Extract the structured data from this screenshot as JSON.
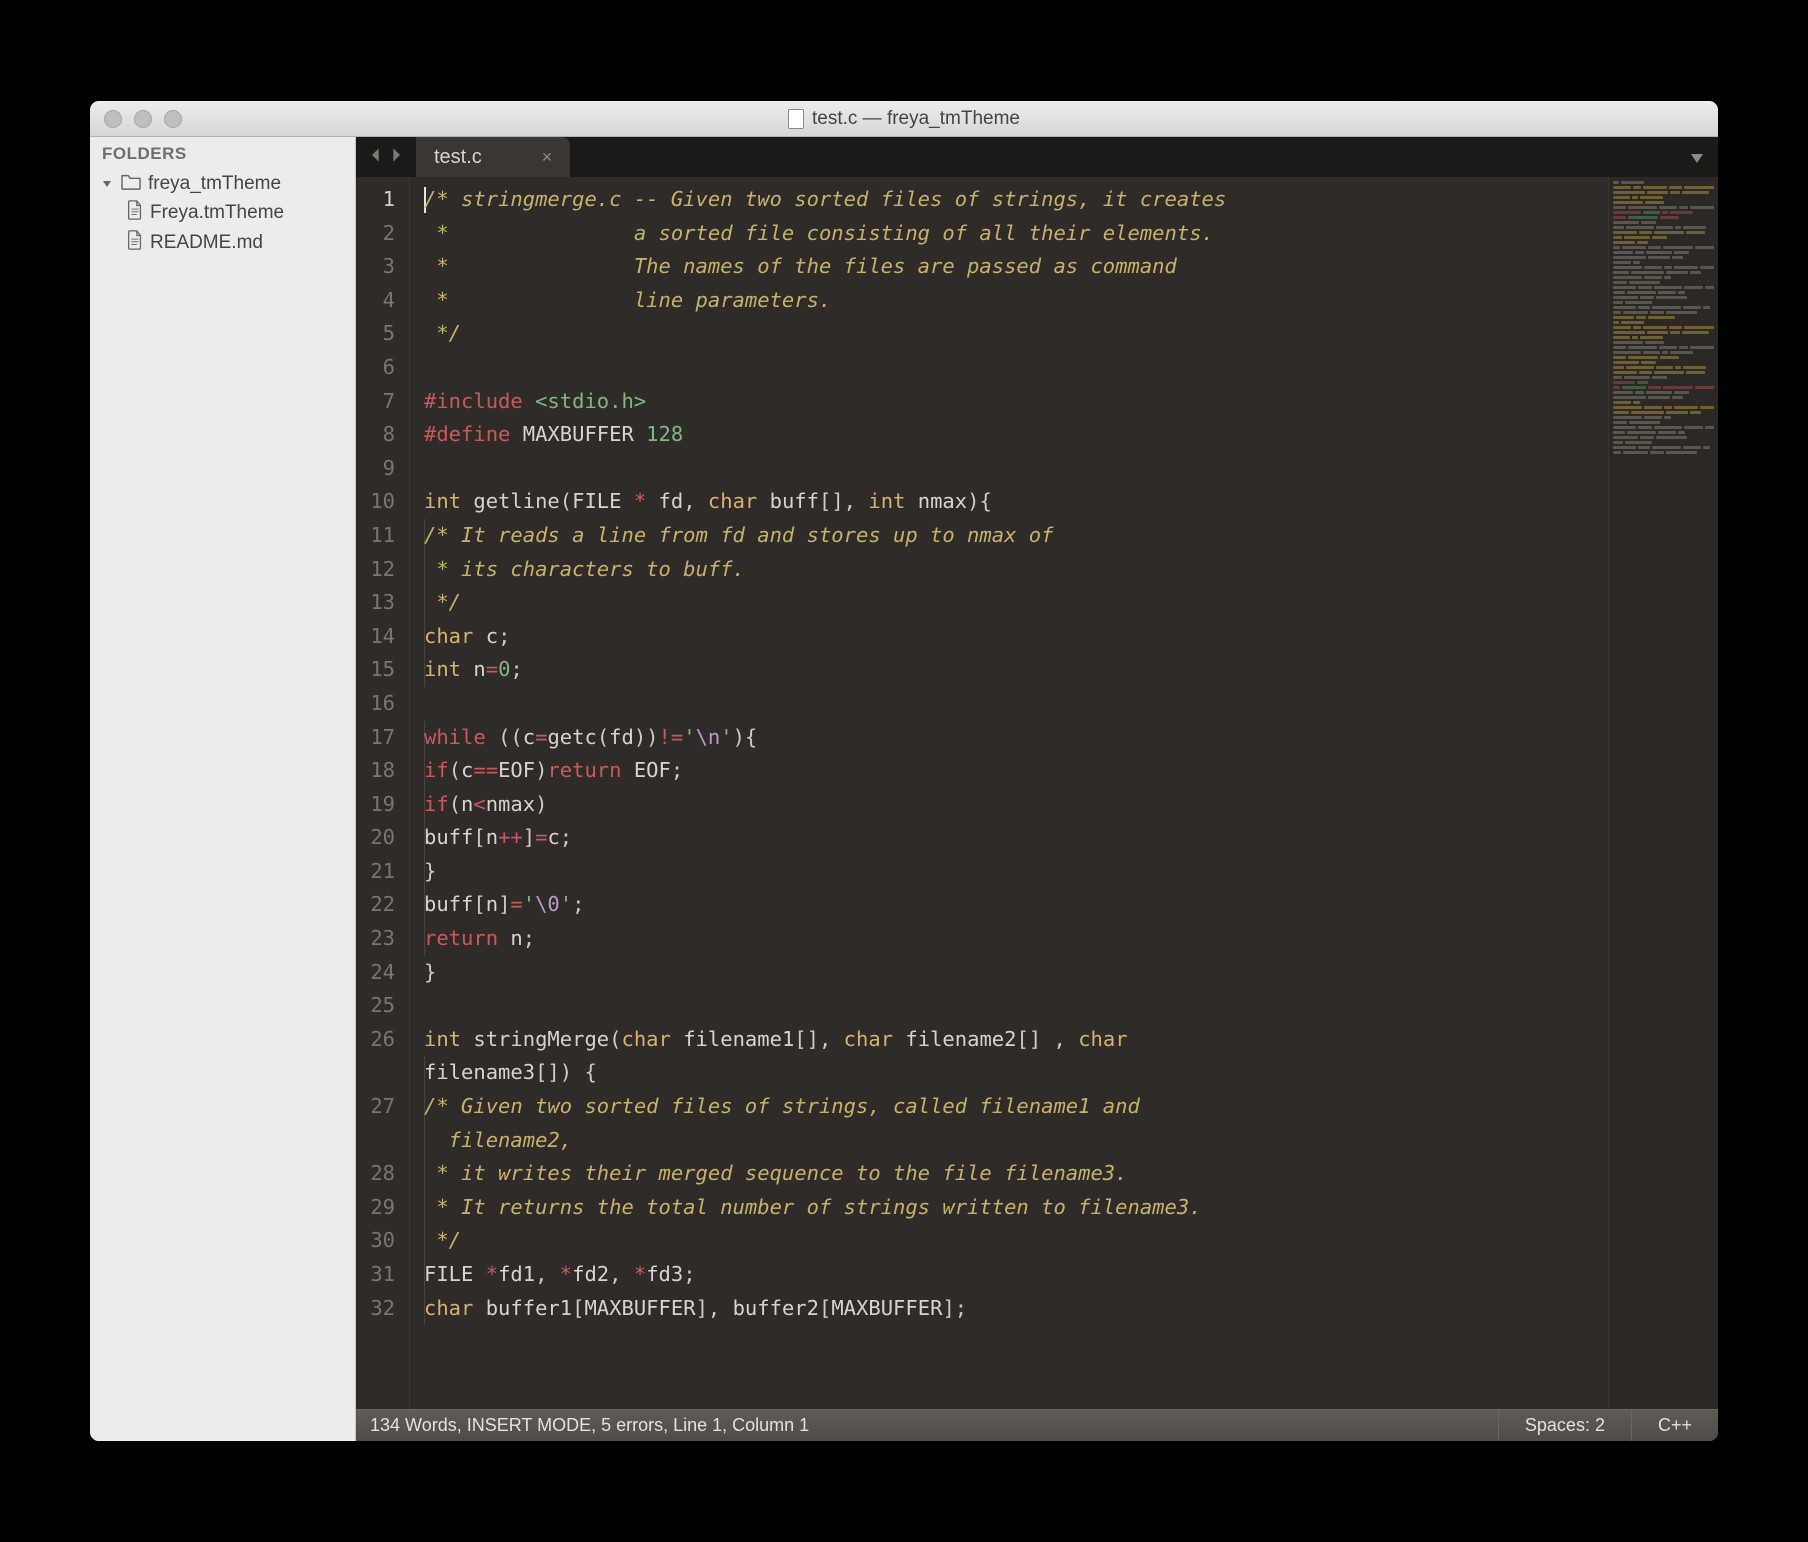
{
  "window": {
    "title": "test.c — freya_tmTheme"
  },
  "sidebar": {
    "header": "FOLDERS",
    "folder": "freya_tmTheme",
    "files": [
      "Freya.tmTheme",
      "README.md"
    ]
  },
  "tabs": {
    "active": "test.c"
  },
  "code": {
    "lines": [
      {
        "n": 1,
        "indent": 0,
        "segs": [
          [
            "cursor",
            ""
          ],
          [
            "c-comment",
            "/* stringmerge.c -- Given two sorted files of strings, it creates"
          ]
        ]
      },
      {
        "n": 2,
        "indent": 0,
        "segs": [
          [
            "c-comment",
            " *               a sorted file consisting of all their elements."
          ]
        ]
      },
      {
        "n": 3,
        "indent": 0,
        "segs": [
          [
            "c-comment",
            " *               The names of the files are passed as command"
          ]
        ]
      },
      {
        "n": 4,
        "indent": 0,
        "segs": [
          [
            "c-comment",
            " *               line parameters."
          ]
        ]
      },
      {
        "n": 5,
        "indent": 0,
        "segs": [
          [
            "c-comment",
            " */"
          ]
        ]
      },
      {
        "n": 6,
        "indent": 0,
        "segs": []
      },
      {
        "n": 7,
        "indent": 0,
        "segs": [
          [
            "c-preproc",
            "#include "
          ],
          [
            "c-string",
            "<stdio.h>"
          ]
        ]
      },
      {
        "n": 8,
        "indent": 0,
        "segs": [
          [
            "c-preproc",
            "#define "
          ],
          [
            "c-ident",
            "MAXBUFFER "
          ],
          [
            "c-number",
            "128"
          ]
        ]
      },
      {
        "n": 9,
        "indent": 0,
        "segs": []
      },
      {
        "n": 10,
        "indent": 0,
        "segs": [
          [
            "c-type",
            "int "
          ],
          [
            "c-func",
            "getline"
          ],
          [
            "c-punct",
            "("
          ],
          [
            "c-ident",
            "FILE "
          ],
          [
            "c-keyword",
            "* "
          ],
          [
            "c-ident",
            "fd"
          ],
          [
            "c-punct",
            ", "
          ],
          [
            "c-type",
            "char "
          ],
          [
            "c-ident",
            "buff"
          ],
          [
            "c-punct",
            "[], "
          ],
          [
            "c-type",
            "int "
          ],
          [
            "c-ident",
            "nmax"
          ],
          [
            "c-punct",
            "){"
          ]
        ]
      },
      {
        "n": 11,
        "indent": 1,
        "segs": [
          [
            "c-comment",
            "/* It reads a line from fd and stores up to nmax of"
          ]
        ]
      },
      {
        "n": 12,
        "indent": 1,
        "segs": [
          [
            "c-comment",
            " * its characters to buff."
          ]
        ]
      },
      {
        "n": 13,
        "indent": 1,
        "segs": [
          [
            "c-comment",
            " */"
          ]
        ]
      },
      {
        "n": 14,
        "indent": 1,
        "segs": [
          [
            "c-type",
            "char "
          ],
          [
            "c-ident",
            "c"
          ],
          [
            "c-punct",
            ";"
          ]
        ]
      },
      {
        "n": 15,
        "indent": 1,
        "segs": [
          [
            "c-type",
            "int "
          ],
          [
            "c-ident",
            "n"
          ],
          [
            "c-keyword",
            "="
          ],
          [
            "c-number",
            "0"
          ],
          [
            "c-punct",
            ";"
          ]
        ]
      },
      {
        "n": 16,
        "indent": 0,
        "segs": []
      },
      {
        "n": 17,
        "indent": 1,
        "segs": [
          [
            "c-keyword",
            "while "
          ],
          [
            "c-punct",
            "(("
          ],
          [
            "c-ident",
            "c"
          ],
          [
            "c-keyword",
            "="
          ],
          [
            "c-func",
            "getc"
          ],
          [
            "c-punct",
            "("
          ],
          [
            "c-ident",
            "fd"
          ],
          [
            "c-punct",
            "))"
          ],
          [
            "c-keyword",
            "!="
          ],
          [
            "c-string",
            "'"
          ],
          [
            "c-escape",
            "\\n"
          ],
          [
            "c-string",
            "'"
          ],
          [
            "c-punct",
            "){"
          ]
        ]
      },
      {
        "n": 18,
        "indent": 2,
        "segs": [
          [
            "c-keyword",
            "if"
          ],
          [
            "c-punct",
            "("
          ],
          [
            "c-ident",
            "c"
          ],
          [
            "c-keyword",
            "=="
          ],
          [
            "c-ident",
            "EOF"
          ],
          [
            "c-punct",
            ")"
          ],
          [
            "c-keyword",
            "return "
          ],
          [
            "c-ident",
            "EOF"
          ],
          [
            "c-punct",
            ";"
          ]
        ]
      },
      {
        "n": 19,
        "indent": 2,
        "segs": [
          [
            "c-keyword",
            "if"
          ],
          [
            "c-punct",
            "("
          ],
          [
            "c-ident",
            "n"
          ],
          [
            "c-keyword",
            "<"
          ],
          [
            "c-ident",
            "nmax"
          ],
          [
            "c-punct",
            ")"
          ]
        ]
      },
      {
        "n": 20,
        "indent": 3,
        "segs": [
          [
            "c-ident",
            "buff"
          ],
          [
            "c-punct",
            "["
          ],
          [
            "c-ident",
            "n"
          ],
          [
            "c-keyword",
            "++"
          ],
          [
            "c-punct",
            "]"
          ],
          [
            "c-keyword",
            "="
          ],
          [
            "c-ident",
            "c"
          ],
          [
            "c-punct",
            ";"
          ]
        ]
      },
      {
        "n": 21,
        "indent": 1,
        "segs": [
          [
            "c-punct",
            "}"
          ]
        ]
      },
      {
        "n": 22,
        "indent": 1,
        "segs": [
          [
            "c-ident",
            "buff"
          ],
          [
            "c-punct",
            "["
          ],
          [
            "c-ident",
            "n"
          ],
          [
            "c-punct",
            "]"
          ],
          [
            "c-keyword",
            "="
          ],
          [
            "c-string",
            "'"
          ],
          [
            "c-escape",
            "\\0"
          ],
          [
            "c-string",
            "'"
          ],
          [
            "c-punct",
            ";"
          ]
        ]
      },
      {
        "n": 23,
        "indent": 1,
        "segs": [
          [
            "c-keyword",
            "return "
          ],
          [
            "c-ident",
            "n"
          ],
          [
            "c-punct",
            ";"
          ]
        ]
      },
      {
        "n": 24,
        "indent": 0,
        "segs": [
          [
            "c-punct",
            "}"
          ]
        ]
      },
      {
        "n": 25,
        "indent": 0,
        "segs": []
      },
      {
        "n": 26,
        "indent": 0,
        "segs": [
          [
            "c-type",
            "int "
          ],
          [
            "c-func",
            "stringMerge"
          ],
          [
            "c-punct",
            "("
          ],
          [
            "c-type",
            "char "
          ],
          [
            "c-ident",
            "filename1"
          ],
          [
            "c-punct",
            "[], "
          ],
          [
            "c-type",
            "char "
          ],
          [
            "c-ident",
            "filename2"
          ],
          [
            "c-punct",
            "[] , "
          ],
          [
            "c-type",
            "char"
          ]
        ]
      },
      {
        "n": "",
        "raw_wrap": true,
        "indent": 1,
        "segs": [
          [
            "c-ident",
            "filename3"
          ],
          [
            "c-punct",
            "[]) {"
          ]
        ]
      },
      {
        "n": 27,
        "indent": 1,
        "segs": [
          [
            "c-comment",
            "/* Given two sorted files of strings, called filename1 and"
          ]
        ]
      },
      {
        "n": "",
        "raw_wrap": true,
        "indent": 1,
        "segs": [
          [
            "c-comment",
            "  filename2,"
          ]
        ]
      },
      {
        "n": 28,
        "indent": 1,
        "segs": [
          [
            "c-comment",
            " * it writes their merged sequence to the file filename3."
          ]
        ]
      },
      {
        "n": 29,
        "indent": 1,
        "segs": [
          [
            "c-comment",
            " * It returns the total number of strings written to filename3."
          ]
        ]
      },
      {
        "n": 30,
        "indent": 1,
        "segs": [
          [
            "c-comment",
            " */"
          ]
        ]
      },
      {
        "n": 31,
        "indent": 1,
        "segs": [
          [
            "c-ident",
            "FILE "
          ],
          [
            "c-keyword",
            "*"
          ],
          [
            "c-ident",
            "fd1"
          ],
          [
            "c-punct",
            ", "
          ],
          [
            "c-keyword",
            "*"
          ],
          [
            "c-ident",
            "fd2"
          ],
          [
            "c-punct",
            ", "
          ],
          [
            "c-keyword",
            "*"
          ],
          [
            "c-ident",
            "fd3"
          ],
          [
            "c-punct",
            ";"
          ]
        ]
      },
      {
        "n": 32,
        "indent": 1,
        "segs": [
          [
            "c-type",
            "char "
          ],
          [
            "c-ident",
            "buffer1"
          ],
          [
            "c-punct",
            "["
          ],
          [
            "c-ident",
            "MAXBUFFER"
          ],
          [
            "c-punct",
            "], "
          ],
          [
            "c-ident",
            "buffer2"
          ],
          [
            "c-punct",
            "["
          ],
          [
            "c-ident",
            "MAXBUFFER"
          ],
          [
            "c-punct",
            "];"
          ]
        ]
      }
    ]
  },
  "status": {
    "left": "134 Words, INSERT MODE, 5 errors, Line 1, Column 1",
    "spaces": "Spaces: 2",
    "lang": "C++"
  },
  "minimap": {
    "colors": {
      "comment": "#6d6133",
      "default": "#5a564e",
      "preproc": "#6a3a3a",
      "string": "#3f5d3f"
    },
    "rows": 55
  }
}
